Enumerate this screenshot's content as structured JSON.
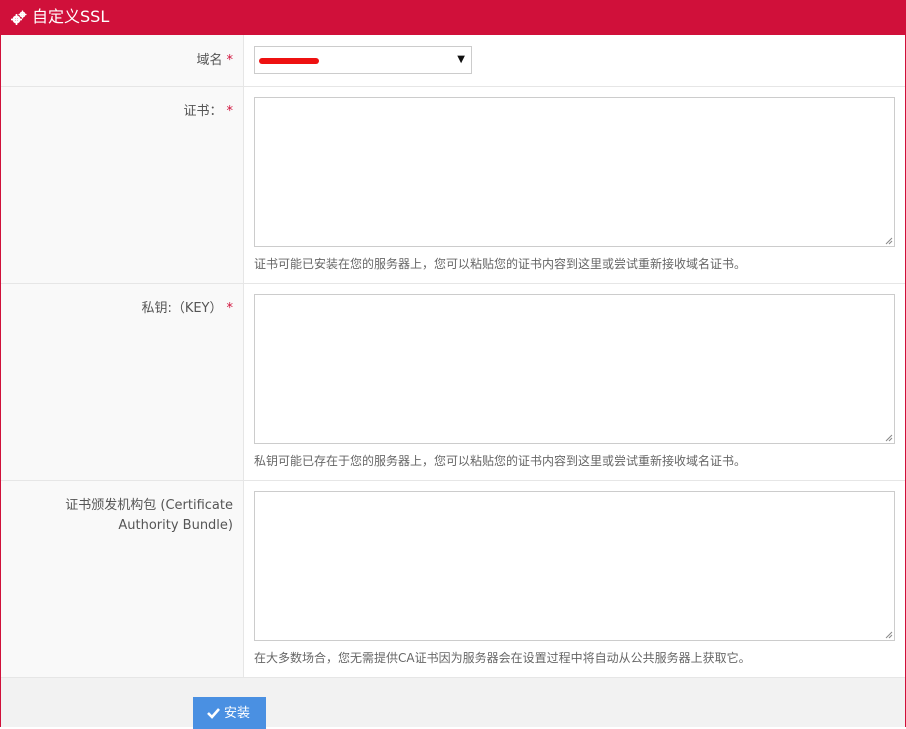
{
  "header": {
    "title": "自定义SSL",
    "icon": "cogs-icon",
    "color": "#d0103a"
  },
  "domain": {
    "label": "域名",
    "required_mark": "*",
    "selected_value": "(redacted)"
  },
  "certificate": {
    "label": "证书：",
    "required_mark": "*",
    "value": "",
    "help": "证书可能已安装在您的服务器上，您可以粘贴您的证书内容到这里或尝试重新接收域名证书。"
  },
  "private_key": {
    "label": "私钥:（KEY）",
    "required_mark": "*",
    "value": "",
    "help": "私钥可能已存在于您的服务器上，您可以粘贴您的证书内容到这里或尝试重新接收域名证书。"
  },
  "ca_bundle": {
    "label_line1": "证书颁发机构包 (Certificate",
    "label_line2": "Authority Bundle)",
    "value": "",
    "help": "在大多数场合，您无需提供CA证书因为服务器会在设置过程中将自动从公共服务器上获取它。"
  },
  "footer": {
    "install_label": "安装",
    "install_icon": "check-icon",
    "button_color": "#4a90e2"
  }
}
